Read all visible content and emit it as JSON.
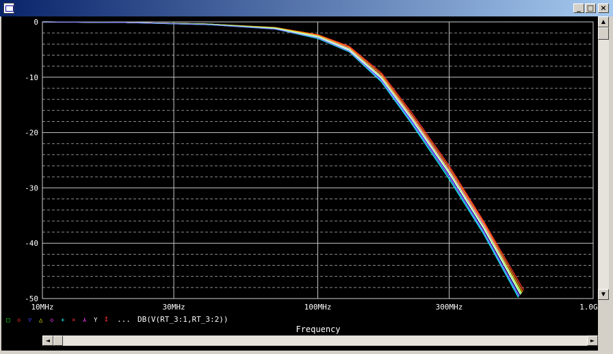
{
  "window": {
    "icon": "probe-app-icon",
    "controls": {
      "minimize": "_",
      "maximize": "□",
      "close": "×"
    }
  },
  "scrollbars": {
    "up": "▲",
    "down": "▼",
    "left": "◄",
    "right": "►"
  },
  "legend": {
    "markers": [
      {
        "symbol": "□",
        "color": "#00ff00"
      },
      {
        "symbol": "◇",
        "color": "#ff3030"
      },
      {
        "symbol": "▽",
        "color": "#4040ff"
      },
      {
        "symbol": "△",
        "color": "#ffff00"
      },
      {
        "symbol": "◇",
        "color": "#ff40ff"
      },
      {
        "symbol": "+",
        "color": "#00ffff"
      },
      {
        "symbol": "×",
        "color": "#ff3030"
      },
      {
        "symbol": "⋏",
        "color": "#ff40ff"
      },
      {
        "symbol": "Y",
        "color": "#ffffff"
      },
      {
        "symbol": "⁑",
        "color": "#ff3030"
      }
    ],
    "ellipsis": "...",
    "expression": "DB(V(RT_3:1,RT_3:2))"
  },
  "chart_data": {
    "type": "line",
    "xlabel": "Frequency",
    "ylabel": "",
    "xscale": "log",
    "xlim": [
      10,
      1000
    ],
    "ylim": [
      -50,
      0
    ],
    "xticks": [
      10,
      30,
      100,
      300,
      1000
    ],
    "xtick_labels": [
      "10MHz",
      "30MHz",
      "100MHz",
      "300MHz",
      "1.0GHz"
    ],
    "yticks": [
      0,
      -10,
      -20,
      -30,
      -40,
      -50
    ],
    "ytick_labels": [
      "0",
      "-10",
      "-20",
      "-30",
      "-40",
      "-50"
    ],
    "grid": true,
    "background": "#000000",
    "x_unit": "MHz",
    "series": [
      {
        "color": "#ff3030",
        "x": [
          10,
          20,
          40,
          70,
          100,
          130,
          170,
          220,
          300,
          400,
          560
        ],
        "y": [
          0,
          -0.1,
          -0.4,
          -1.0,
          -2.3,
          -4.4,
          -9.2,
          -16.5,
          -26.0,
          -36.0,
          -48.5
        ]
      },
      {
        "color": "#ff40ff",
        "x": [
          10,
          20,
          40,
          70,
          100,
          130,
          170,
          220,
          300,
          400,
          550
        ],
        "y": [
          0,
          -0.1,
          -0.4,
          -1.1,
          -2.5,
          -4.8,
          -9.8,
          -17.2,
          -26.8,
          -36.6,
          -49.0
        ]
      },
      {
        "color": "#4040ff",
        "x": [
          10,
          20,
          40,
          70,
          100,
          130,
          170,
          220,
          300,
          400,
          540
        ],
        "y": [
          0,
          -0.1,
          -0.5,
          -1.2,
          -2.8,
          -5.2,
          -10.4,
          -18.0,
          -27.8,
          -37.8,
          -49.5
        ]
      },
      {
        "color": "#00ffff",
        "x": [
          10,
          20,
          40,
          70,
          100,
          130,
          170,
          220,
          300,
          400,
          535
        ],
        "y": [
          0,
          -0.1,
          -0.5,
          -1.3,
          -3.0,
          -5.4,
          -10.8,
          -18.5,
          -28.4,
          -38.3,
          -49.8
        ]
      },
      {
        "color": "#00ff00",
        "x": [
          10,
          20,
          40,
          70,
          100,
          130,
          170,
          220,
          300,
          400,
          545
        ],
        "y": [
          0,
          -0.1,
          -0.5,
          -1.2,
          -2.7,
          -5.0,
          -10.0,
          -17.6,
          -27.2,
          -37.2,
          -49.2
        ]
      },
      {
        "color": "#ffff00",
        "x": [
          10,
          20,
          40,
          70,
          100,
          130,
          170,
          220,
          300,
          400,
          550
        ],
        "y": [
          0,
          -0.1,
          -0.4,
          -1.1,
          -2.6,
          -4.9,
          -9.9,
          -17.4,
          -27.0,
          -36.9,
          -49.0
        ]
      },
      {
        "color": "#ffffff",
        "x": [
          10,
          20,
          40,
          70,
          100,
          130,
          170,
          220,
          300,
          400,
          545
        ],
        "y": [
          0,
          -0.1,
          -0.4,
          -1.2,
          -2.7,
          -5.1,
          -10.2,
          -17.7,
          -27.4,
          -37.3,
          -49.3
        ]
      },
      {
        "color": "#ffa000",
        "x": [
          10,
          20,
          40,
          70,
          100,
          130,
          170,
          220,
          300,
          400,
          555
        ],
        "y": [
          0,
          -0.1,
          -0.4,
          -1.0,
          -2.4,
          -4.6,
          -9.5,
          -16.9,
          -26.4,
          -36.3,
          -48.8
        ]
      },
      {
        "color": "#a0ffa0",
        "x": [
          10,
          20,
          40,
          70,
          100,
          130,
          170,
          220,
          300,
          400,
          548
        ],
        "y": [
          0,
          -0.1,
          -0.4,
          -1.1,
          -2.6,
          -4.9,
          -10.0,
          -17.5,
          -27.1,
          -37.0,
          -49.1
        ]
      },
      {
        "color": "#8080ff",
        "x": [
          10,
          20,
          40,
          70,
          100,
          130,
          170,
          220,
          300,
          400,
          538
        ],
        "y": [
          0,
          -0.1,
          -0.5,
          -1.3,
          -2.9,
          -5.3,
          -10.6,
          -18.2,
          -28.0,
          -38.0,
          -49.6
        ]
      }
    ]
  }
}
